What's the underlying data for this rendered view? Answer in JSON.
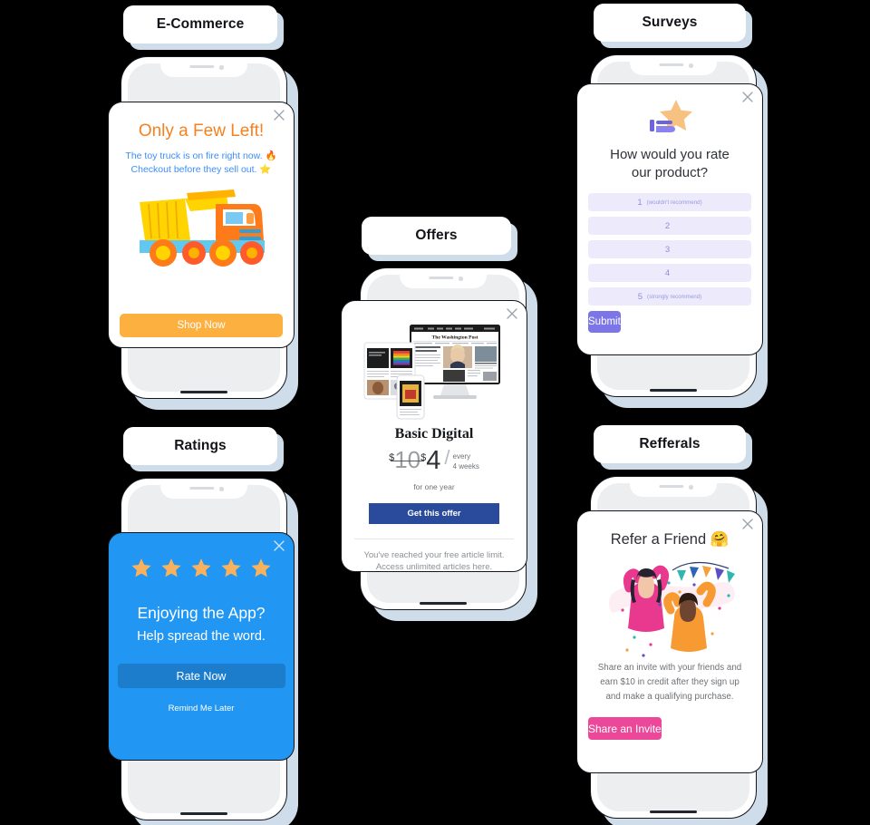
{
  "page": {
    "background": "#000000",
    "accent_blue": "#2196f3",
    "accent_orange": "#f58220",
    "accent_purple": "#7b75e8",
    "accent_pink": "#ec4899",
    "shadow_color": "#cfdcea"
  },
  "cards": {
    "ecommerce": {
      "tab_label": "E-Commerce",
      "close_icon": "close-icon",
      "title": "Only a Few Left!",
      "subtitle_line1": "The toy truck is on fire right now. 🔥",
      "subtitle_line2": "Checkout before they sell out. ⭐",
      "image_name": "toy-dump-truck-image",
      "cta_label": "Shop Now",
      "cta_color": "#fbb040"
    },
    "ratings": {
      "tab_label": "Ratings",
      "close_icon": "close-icon",
      "stars": 5,
      "star_color": "#f9b15c",
      "title": "Enjoying the App?",
      "subtitle": "Help spread the word.",
      "cta_label": "Rate Now",
      "secondary_label": "Remind Me Later",
      "card_color": "#2196f3",
      "cta_color": "#1c7dcd"
    },
    "offers": {
      "tab_label": "Offers",
      "close_icon": "close-icon",
      "image_name": "washington-post-devices-image",
      "plan_title": "Basic Digital",
      "currency": "$",
      "old_price": "10",
      "new_price": "4",
      "period_line1": "every",
      "period_line2": "4 weeks",
      "term": "for one year",
      "cta_label": "Get this offer",
      "cta_color": "#2a4b9b",
      "footer_line1": "You've reached your free article limit.",
      "footer_line2": "Access unlimited articles here."
    },
    "surveys": {
      "tab_label": "Surveys",
      "close_icon": "close-icon",
      "icon_name": "hand-holding-star-icon",
      "question_line1": "How would you rate",
      "question_line2": "our product?",
      "options": [
        {
          "number": "1",
          "note": "(wouldn't recommend)"
        },
        {
          "number": "2",
          "note": ""
        },
        {
          "number": "3",
          "note": ""
        },
        {
          "number": "4",
          "note": ""
        },
        {
          "number": "5",
          "note": "(strongly recommend)"
        }
      ],
      "cta_label": "Submit",
      "cta_color": "#7b75e8"
    },
    "referrals": {
      "tab_label": "Refferals",
      "close_icon": "close-icon",
      "title": "Refer a Friend 🤗",
      "image_name": "celebrating-people-illustration",
      "body_line1": "Share an invite with your friends and",
      "body_line2": "earn $10 in credit after they sign up",
      "body_line3": "and make a qualifying purchase.",
      "cta_label": "Share an Invite",
      "cta_color": "#ec4899"
    }
  }
}
